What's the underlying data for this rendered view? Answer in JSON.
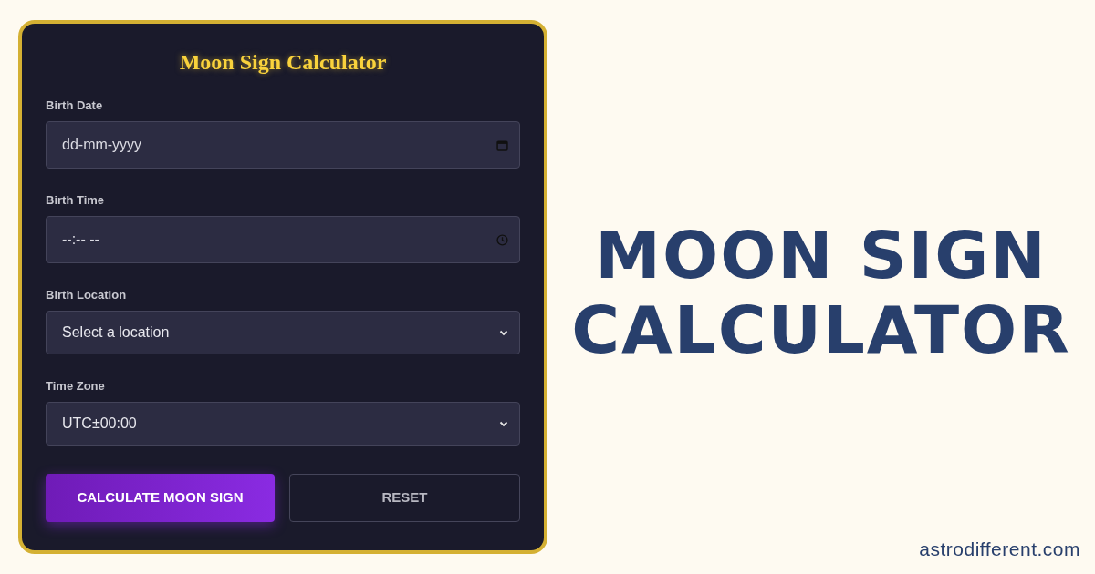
{
  "form": {
    "title": "Moon Sign Calculator",
    "fields": [
      {
        "kind": "date",
        "label": "Birth Date",
        "placeholder": "dd-mm-yyyy"
      },
      {
        "kind": "time",
        "label": "Birth Time",
        "placeholder": "--:-- --"
      },
      {
        "kind": "select",
        "label": "Birth Location",
        "value": "Select a location"
      },
      {
        "kind": "select",
        "label": "Time Zone",
        "value": "UTC±00:00"
      }
    ],
    "buttons": [
      {
        "kind": "primary",
        "label": "CALCULATE MOON SIGN"
      },
      {
        "kind": "secondary",
        "label": "RESET"
      }
    ]
  },
  "headline": [
    "MOON SIGN",
    "CALCULATOR"
  ],
  "site": "astrodifferent.com"
}
